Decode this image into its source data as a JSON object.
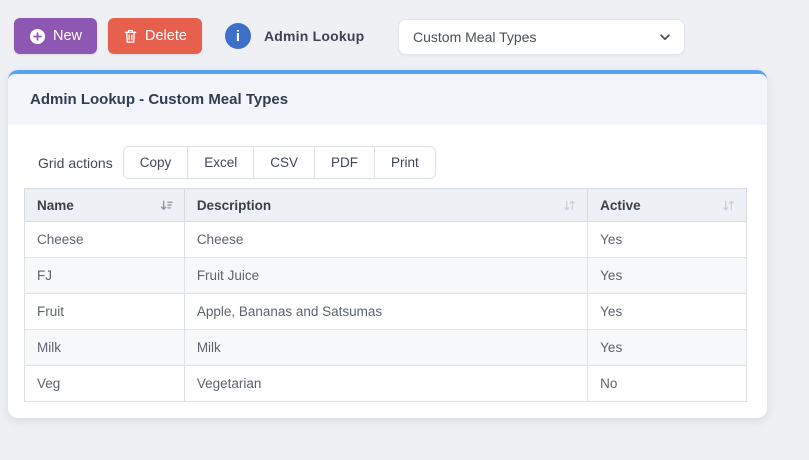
{
  "toolbar": {
    "new_button_label": "New",
    "delete_button_label": "Delete",
    "info_icon_glyph": "i",
    "info_label": "Admin Lookup",
    "dropdown_selected": "Custom Meal Types"
  },
  "card": {
    "title": "Admin Lookup - Custom Meal Types",
    "grid_actions": {
      "label": "Grid actions",
      "buttons": [
        "Copy",
        "Excel",
        "CSV",
        "PDF",
        "Print"
      ]
    },
    "table": {
      "columns": [
        {
          "label": "Name",
          "sort_state": "sorted-descending"
        },
        {
          "label": "Description",
          "sort_state": "unsorted"
        },
        {
          "label": "Active",
          "sort_state": "unsorted"
        }
      ],
      "rows": [
        {
          "name": "Cheese",
          "description": "Cheese",
          "active": "Yes"
        },
        {
          "name": "FJ",
          "description": "Fruit Juice",
          "active": "Yes"
        },
        {
          "name": "Fruit",
          "description": "Apple, Bananas and Satsumas",
          "active": "Yes"
        },
        {
          "name": "Milk",
          "description": "Milk",
          "active": "Yes"
        },
        {
          "name": "Veg",
          "description": "Vegetarian",
          "active": "No"
        }
      ]
    }
  },
  "colors": {
    "page_background": "#eef0f4",
    "new_button": "#8e57b4",
    "delete_button": "#e7604e",
    "info_icon": "#3e6fc9",
    "card_accent": "#57a0f6",
    "header_band": "#f2f5f9",
    "table_header_bg": "#edf0f4"
  }
}
